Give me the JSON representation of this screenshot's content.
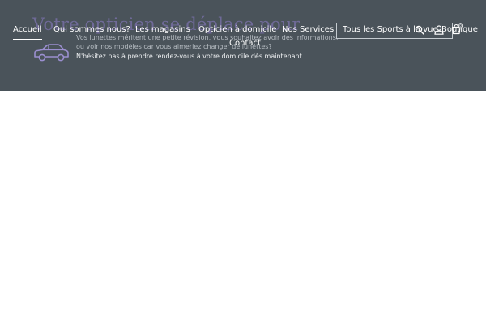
{
  "hero": {
    "title": "Votre opticien se déplace pour vous",
    "line1": "Vos lunettes méritent une petite révision, vous souhaitez avoir des informations,",
    "line2": "ou voir nos modèles car vous aimeriez changer de lunettes?",
    "line3": "N'hésitez pas à prendre rendez-vous à votre domicile dès maintenant",
    "icon": "car-icon"
  },
  "nav": {
    "accueil": "Accueil",
    "qui": "Qui sommes nous?",
    "magasins": "Les magasins",
    "opticien": "Opticien à domicile",
    "services": "Nos Services",
    "sports": "Tous les Sports à la vue",
    "boutique": "Boutique",
    "contact": "Contact"
  },
  "icons": {
    "search": "search-icon",
    "account": "user-icon",
    "cart": "cart-icon",
    "cart_count": "0"
  },
  "colors": {
    "header_bg": "#4a535a",
    "hero_title": "#6f6a98",
    "car_icon": "#9b8fd0",
    "nav_text": "#ffffff"
  }
}
